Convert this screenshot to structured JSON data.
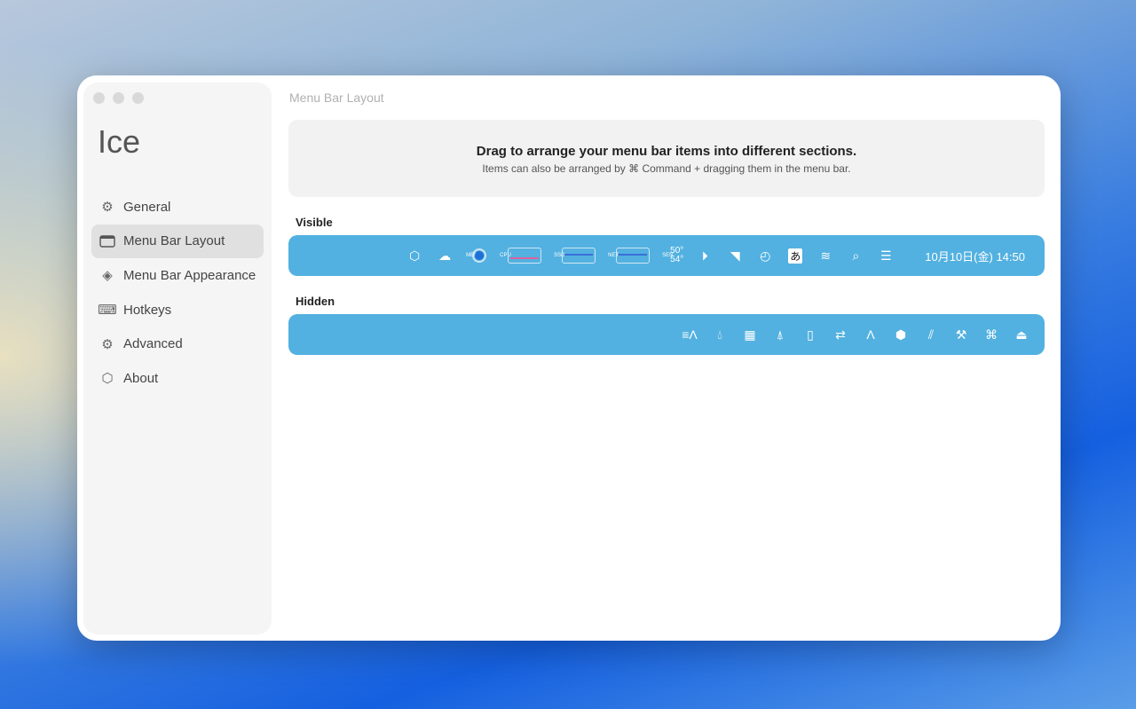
{
  "sidebar": {
    "title": "Ice",
    "items": [
      {
        "label": "General",
        "icon": "gear-icon"
      },
      {
        "label": "Menu Bar Layout",
        "icon": "menubar-icon",
        "selected": true
      },
      {
        "label": "Menu Bar Appearance",
        "icon": "appearance-icon"
      },
      {
        "label": "Hotkeys",
        "icon": "keyboard-icon"
      },
      {
        "label": "Advanced",
        "icon": "gears-icon"
      },
      {
        "label": "About",
        "icon": "cube-icon"
      }
    ]
  },
  "main": {
    "header": "Menu Bar Layout",
    "info_title": "Drag to arrange your menu bar items into different sections.",
    "info_subtitle": "Items can also be arranged by ⌘ Command + dragging them in the menu bar.",
    "visible_label": "Visible",
    "hidden_label": "Hidden",
    "visible": {
      "mem": "MEM",
      "cpu": "CPU",
      "ssd": "SSD",
      "net": "NET",
      "sen": "SEN",
      "temp1": "50°",
      "temp2": "54°",
      "ime": "あ",
      "clock": "10月10日(金)  14:50"
    }
  },
  "colors": {
    "bar": "#52b1e0",
    "accent_pink": "#e0609c"
  }
}
